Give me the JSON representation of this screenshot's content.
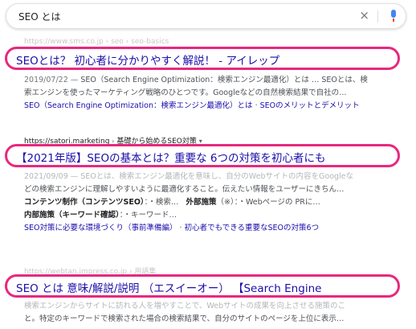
{
  "search": {
    "query": "SEO とは",
    "clear_label": "×"
  },
  "results": [
    {
      "cite": "https://www.sms.co.jp › seo › seo-basics",
      "title": "SEOとは？ 初心者に分かりやすく解説！ - アイレップ",
      "date": "2019/07/22 —",
      "snippet1": "SEO（Search Engine Optimization：検索エンジン最適化）とは … SEOとは、検",
      "snippet2": "索エンジンを使ったマーケティング戦略のひとつです。Googleなどの自然検索結果で自社の…",
      "link1": "SEO（Search Engine Optimization：検索エンジン最適化）とは",
      "link2": "SEOのメリットとデメリット"
    },
    {
      "cite": "https://satori.marketing",
      "cite_path": "基礎から始めるSEO対策",
      "title": "【2021年版】SEOの基本とは？重要な 6つの対策を初心者にも",
      "snippet1": "2021/09/09 — SEOとは、検索エンジン最適化を意味し、自分のWebサイトの内容をGoogleな",
      "snippet2": "どの検索エンジンに理解しやすいように最適化すること。伝えたい情報をユーザーにきちん…",
      "sub1_label": "コンテンツ制作（コンテンツSEO）",
      "sub1_text": "：・検索…",
      "sub1b_label": "外部施策",
      "sub1b_text": "（※）：・Webページの PRに…",
      "sub2_label": "内部施策（キーワード確認）",
      "sub2_text": "：・キーワード…",
      "link1": "SEO対策に必要な環境づくり（事前準備編）",
      "link2": "初心者でもできる重要なSEOの対策6つ"
    },
    {
      "cite": "https://webtan.impress.co.jp › 用語集",
      "title": "SEO とは 意味/解説/説明 （エスイーオー） 【Search Engine",
      "snippet1": "検索エンジンからサイトに訪れる人を増やすことで、Webサイトの成果を向上させる施策のこ",
      "snippet2": "と。特定のキーワードで検索された場合の検索結果で、自分のサイトのページを上位に表示…"
    }
  ],
  "colors": {
    "highlight_border": "#e8287e",
    "link": "#1a0dab"
  }
}
